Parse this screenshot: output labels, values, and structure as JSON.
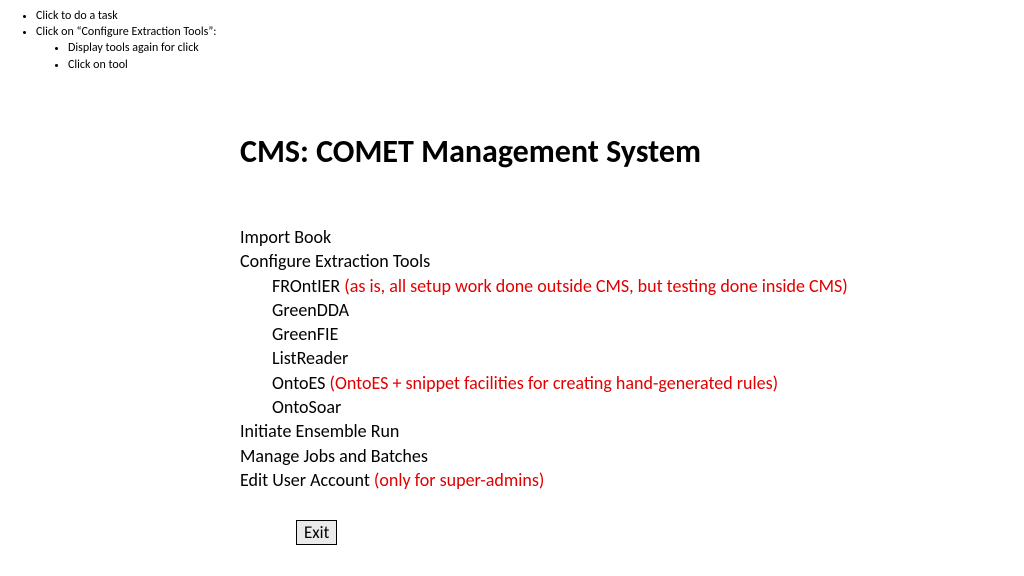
{
  "notes": {
    "n1": "Click to do a task",
    "n2": "Click on “Configure Extraction Tools”:",
    "n2a": "Display tools again for click",
    "n2b": "Click on tool"
  },
  "title": "CMS: COMET Management System",
  "menu": {
    "import_book": "Import Book",
    "configure": "Configure Extraction Tools",
    "tools": {
      "frontier": "FROntIER",
      "frontier_note": " (as is, all setup work done outside CMS, but testing done inside CMS)",
      "greendda": "GreenDDA",
      "greenfie": "GreenFIE",
      "listreader": "ListReader",
      "ontoes": "OntoES",
      "ontoes_note": " (OntoES + snippet facilities for creating hand-generated rules)",
      "ontosoar": "OntoSoar"
    },
    "initiate": "Initiate Ensemble Run",
    "manage": "Manage Jobs and Batches",
    "edit_user": "Edit User Account",
    "edit_user_note": " (only for super-admins)"
  },
  "exit": "Exit"
}
